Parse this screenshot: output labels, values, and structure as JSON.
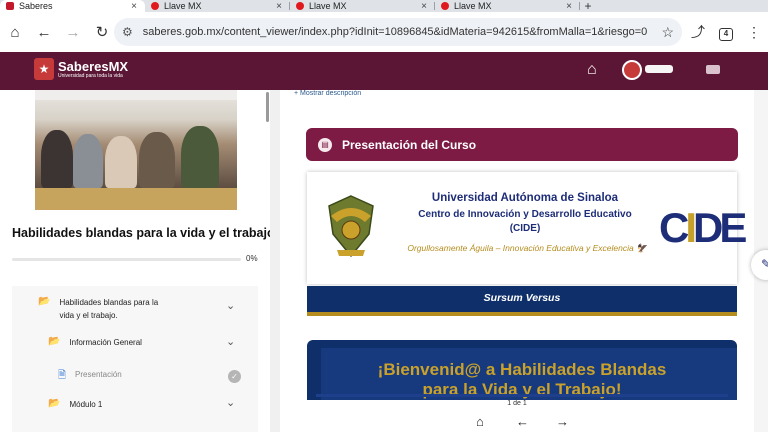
{
  "browser": {
    "tabs": [
      {
        "title": "Saberes",
        "active": true
      },
      {
        "title": "Llave MX",
        "active": false
      },
      {
        "title": "Llave MX",
        "active": false
      },
      {
        "title": "Llave MX",
        "active": false
      }
    ],
    "new_tab": "+",
    "close": "×",
    "url": "saberes.gob.mx/content_viewer/index.php?idInit=10896845&idMateria=942615&fromMalla=1&riesgo=0",
    "tab_count": "4"
  },
  "app": {
    "brand": "SaberesMX",
    "tagline": "Universidad para toda la vida"
  },
  "sidebar": {
    "course_title": "Habilidades blandas para la vida y el trabajo.",
    "progress_percent": 0,
    "progress_label": "0%",
    "toc": [
      {
        "label_line1": "Habilidades blandas para la",
        "label_line2": "vida y el trabajo."
      },
      {
        "label": "Información General"
      },
      {
        "label": "Presentación"
      },
      {
        "label": "Módulo 1"
      }
    ]
  },
  "content": {
    "show_description": "+ Mostrar descripción",
    "section_title": "Presentación del Curso",
    "university": "Universidad Autónoma de Sinaloa",
    "center_line1": "Centro de Innovación y Desarrollo Educativo",
    "center_line2": "(CIDE)",
    "motto": "Orgullosamente Águila – Innovación Educativa y Excelencia 🦅",
    "cide_logo": {
      "c": "C",
      "i": "I",
      "de": "DE"
    },
    "sursum": "Sursum Versus",
    "welcome_line1": "¡Bienvenid@ a Habilidades Blandas",
    "welcome_line2": "para la Vida y el Trabajo!",
    "pager": "1 de 1"
  },
  "colors": {
    "header_maroon": "#5a1634",
    "section_maroon": "#7d1b44",
    "navy": "#0f2f6a",
    "gold": "#b58c1e"
  }
}
